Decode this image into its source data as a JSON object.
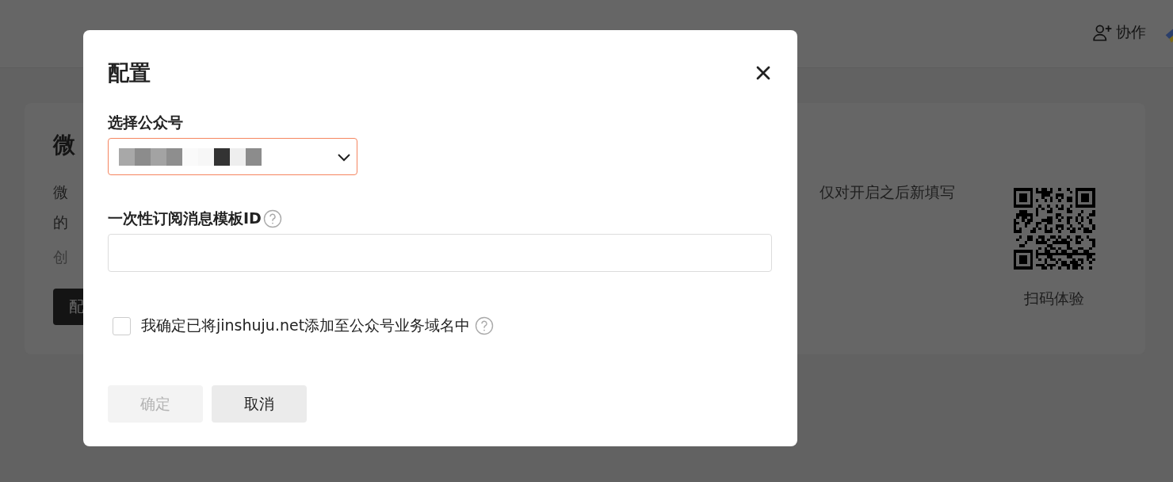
{
  "header": {
    "collaborate_label": "协作"
  },
  "background_card": {
    "title": "微",
    "description_lines": [
      "微",
      "的"
    ],
    "note": "创",
    "button": "配",
    "right_text": "仅对开启之后新填写",
    "qr_caption": "扫码体验"
  },
  "dialog": {
    "title": "配置",
    "fields": [
      {
        "kind": "select",
        "label": "选择公众号",
        "help": false,
        "invalid": true
      },
      {
        "kind": "text",
        "label": "一次性订阅消息模板ID",
        "help": true,
        "invalid": false
      }
    ],
    "confirm": {
      "label": "我确定已将jinshuju.net添加至公众号业务域名中",
      "checked": false,
      "help": true
    },
    "buttons": [
      {
        "label": "确定",
        "disabled": true
      },
      {
        "label": "取消",
        "disabled": false
      }
    ]
  }
}
